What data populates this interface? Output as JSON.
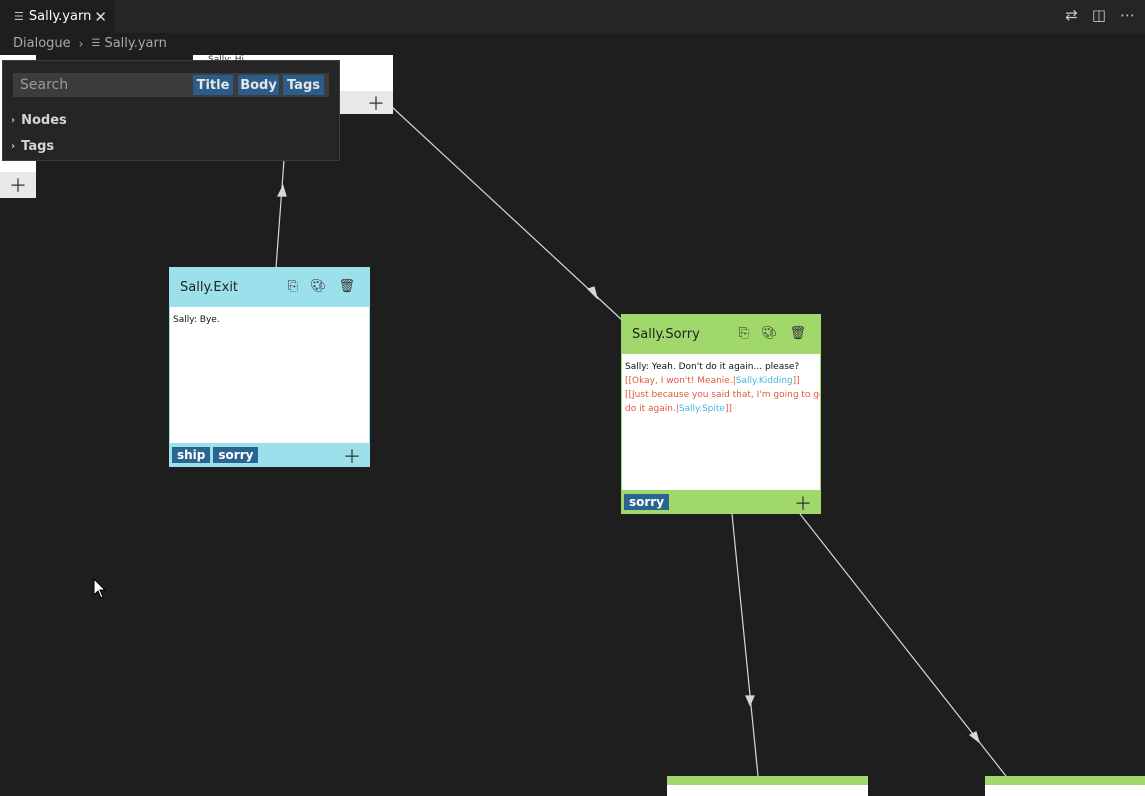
{
  "tab": {
    "title": "Sally.yarn",
    "close_icon": "close-icon"
  },
  "breadcrumb": {
    "root": "Dialogue",
    "file": "Sally.yarn"
  },
  "search": {
    "placeholder": "Search",
    "filters": [
      "Title",
      "Body",
      "Tags"
    ],
    "tree": [
      {
        "label": "Nodes"
      },
      {
        "label": "Tags"
      }
    ]
  },
  "nodes": {
    "top": {
      "body_line": "Sally: Hi"
    },
    "exit": {
      "title": "Sally.Exit",
      "body_line1": "Sally: Bye.",
      "tags": [
        "ship",
        "sorry"
      ],
      "color": "#9ce0ec"
    },
    "sorry": {
      "title": "Sally.Sorry",
      "body_line1": "Sally: Yeah. Don't do it again... please?",
      "link1_text": "[[Okay, I won't! Meanie.|",
      "link1_target": "Sally.Kidding",
      "link1_end": "]]",
      "link2_text_a": "[[Just because you said that, I'm going to go",
      "link2_text_b": "do it again.|",
      "link2_target": "Sally.Spite",
      "link2_end": "]]",
      "tags": [
        "sorry"
      ],
      "color": "#a1d86c"
    }
  },
  "colors": {
    "background": "#1e1e1e",
    "tag": "#2a6592",
    "link": "#e0583b",
    "link_target": "#41b6e6"
  }
}
